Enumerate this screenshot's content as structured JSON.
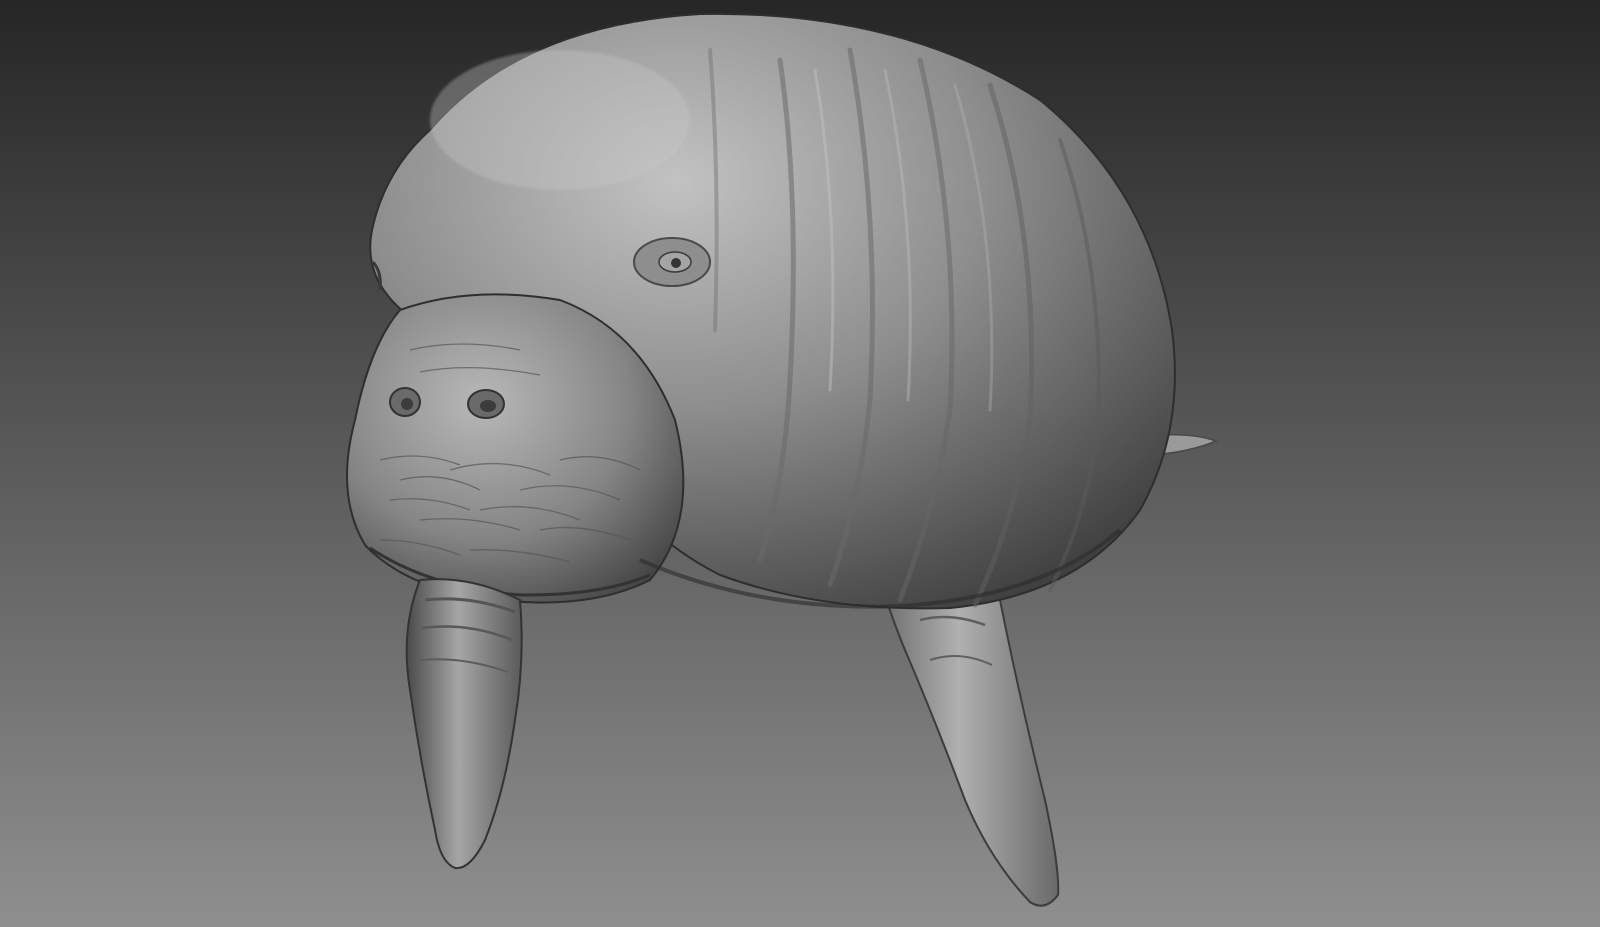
{
  "scene": {
    "subject": "manatee-sculpt",
    "render_style": "grayscale-matcap",
    "colors": {
      "background_top": "#262626",
      "background_bottom": "#8f8f8f",
      "clay_light": "#bdbdbd",
      "clay_mid": "#8a8a8a",
      "clay_dark": "#3e3e3e",
      "shadow": "#2a2a2a"
    }
  }
}
